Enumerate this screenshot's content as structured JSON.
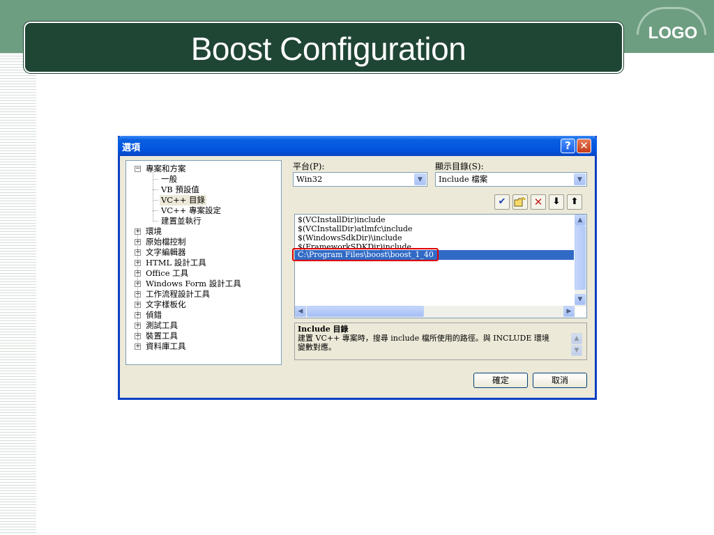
{
  "slide": {
    "title": "Boost Configuration",
    "logo": "LOGO"
  },
  "dialog": {
    "title": "選項",
    "help_label": "?",
    "close_label": "✕",
    "tree": [
      {
        "label": "專案和方案",
        "expander": "−",
        "level": 0
      },
      {
        "label": "一般",
        "level": 1
      },
      {
        "label": "VB 預設值",
        "level": 1
      },
      {
        "label": "VC++ 目錄",
        "level": 1,
        "selected": true
      },
      {
        "label": "VC++ 專案設定",
        "level": 1
      },
      {
        "label": "建置並執行",
        "level": 1
      },
      {
        "label": "環境",
        "expander": "+",
        "level": 0
      },
      {
        "label": "原始檔控制",
        "expander": "+",
        "level": 0
      },
      {
        "label": "文字編輯器",
        "expander": "+",
        "level": 0
      },
      {
        "label": "HTML 設計工具",
        "expander": "+",
        "level": 0
      },
      {
        "label": "Office 工具",
        "expander": "+",
        "level": 0
      },
      {
        "label": "Windows Form 設計工具",
        "expander": "+",
        "level": 0
      },
      {
        "label": "工作流程設計工具",
        "expander": "+",
        "level": 0
      },
      {
        "label": "文字樣板化",
        "expander": "+",
        "level": 0
      },
      {
        "label": "偵錯",
        "expander": "+",
        "level": 0
      },
      {
        "label": "測試工具",
        "expander": "+",
        "level": 0
      },
      {
        "label": "裝置工具",
        "expander": "+",
        "level": 0
      },
      {
        "label": "資料庫工具",
        "expander": "+",
        "level": 0
      }
    ],
    "platform_label": "平台(P):",
    "platform_value": "Win32",
    "show_dirs_label": "顯示目錄(S):",
    "show_dirs_value": "Include 檔案",
    "toolbar": {
      "check_icon": "✔",
      "new_folder_icon": "📁",
      "delete_icon": "✕",
      "down_icon": "⬇",
      "up_icon": "⬆"
    },
    "directories": [
      "$(VCInstallDir)include",
      "$(VCInstallDir)atlmfc\\include",
      "$(WindowsSdkDir)\\include",
      "$(FrameworkSDKDir)include",
      "C:\\Program Files\\boost\\boost_1_40"
    ],
    "description_title": "Include 目錄",
    "description_text_1": "建置 VC++ 專案時，搜尋 include 檔所使用的路徑。與 INCLUDE 環境",
    "description_text_2": "變數對應。",
    "ok_label": "確定",
    "cancel_label": "取消",
    "colors": {
      "titlebar": "#0254de",
      "selection": "#316ac5",
      "highlight_border": "#e00000"
    }
  }
}
